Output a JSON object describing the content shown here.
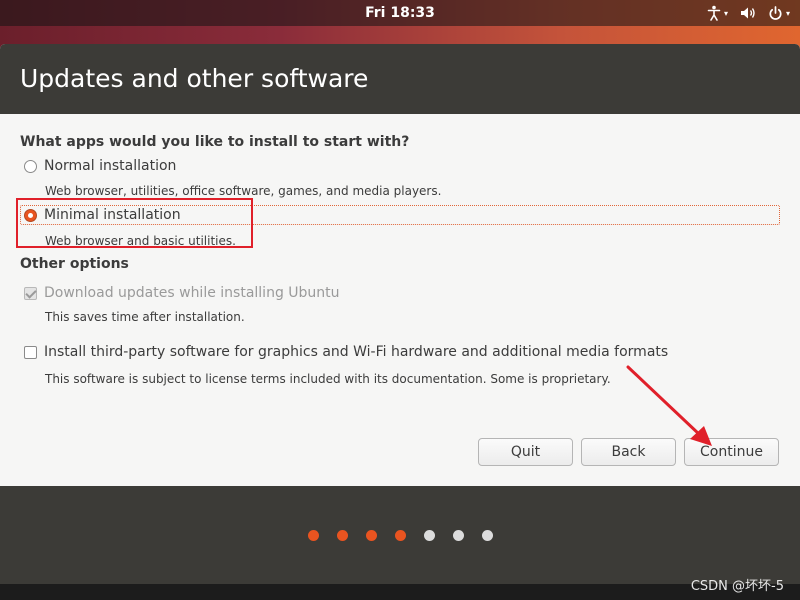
{
  "topbar": {
    "clock": "Fri 18:33",
    "tray": [
      {
        "icon": "accessibility-icon"
      },
      {
        "icon": "volume-icon"
      },
      {
        "icon": "power-icon"
      }
    ]
  },
  "window": {
    "title": "Updates and other software",
    "apps_section": {
      "title": "What apps would you like to install to start with?",
      "options": [
        {
          "label": "Normal installation",
          "description": "Web browser, utilities, office software, games, and media players.",
          "selected": false
        },
        {
          "label": "Minimal installation",
          "description": "Web browser and basic utilities.",
          "selected": true
        }
      ]
    },
    "other_section": {
      "title": "Other options",
      "options": [
        {
          "label": "Download updates while installing Ubuntu",
          "description": "This saves time after installation.",
          "checked": true,
          "disabled": true
        },
        {
          "label": "Install third-party software for graphics and Wi-Fi hardware and additional media formats",
          "description": "This software is subject to license terms included with its documentation. Some is proprietary.",
          "checked": false,
          "disabled": false
        }
      ]
    },
    "buttons": {
      "quit": "Quit",
      "back": "Back",
      "continue": "Continue"
    }
  },
  "progress": {
    "total_steps": 7,
    "completed_steps": 4,
    "active_color": "#e95420",
    "inactive_color": "#dcdcdc"
  },
  "colors": {
    "accent": "#e95420",
    "header_bg": "#3c3b37",
    "annotation_red": "#e0202a"
  },
  "watermark": "CSDN @坏坏-5"
}
